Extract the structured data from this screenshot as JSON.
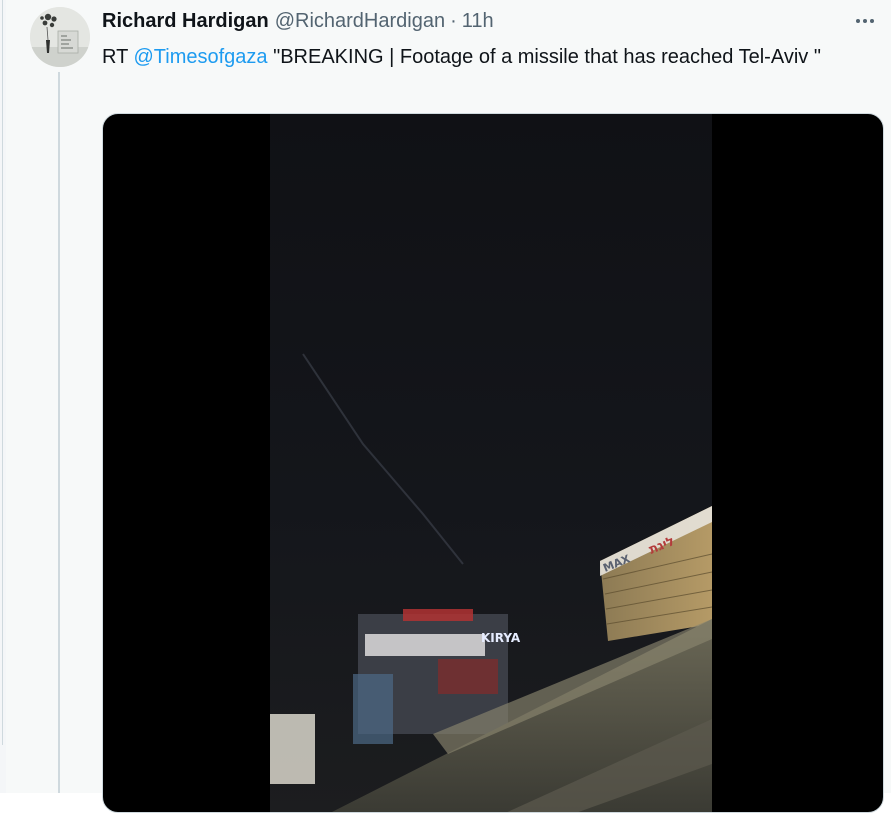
{
  "tweet": {
    "display_name": "Richard Hardigan",
    "handle": "@RichardHardigan",
    "separator": "·",
    "timestamp": "11h",
    "text_prefix": "RT ",
    "mention": "@Timesofgaza",
    "text_body": " \"BREAKING | Footage of a missile that has reached Tel-Aviv \""
  },
  "video": {
    "sign_left": "KIRYA",
    "sign_right": "ליגת",
    "sign_max": "MAX"
  },
  "icons": {
    "more": "more-horizontal-icon",
    "avatar": "avatar-image"
  }
}
